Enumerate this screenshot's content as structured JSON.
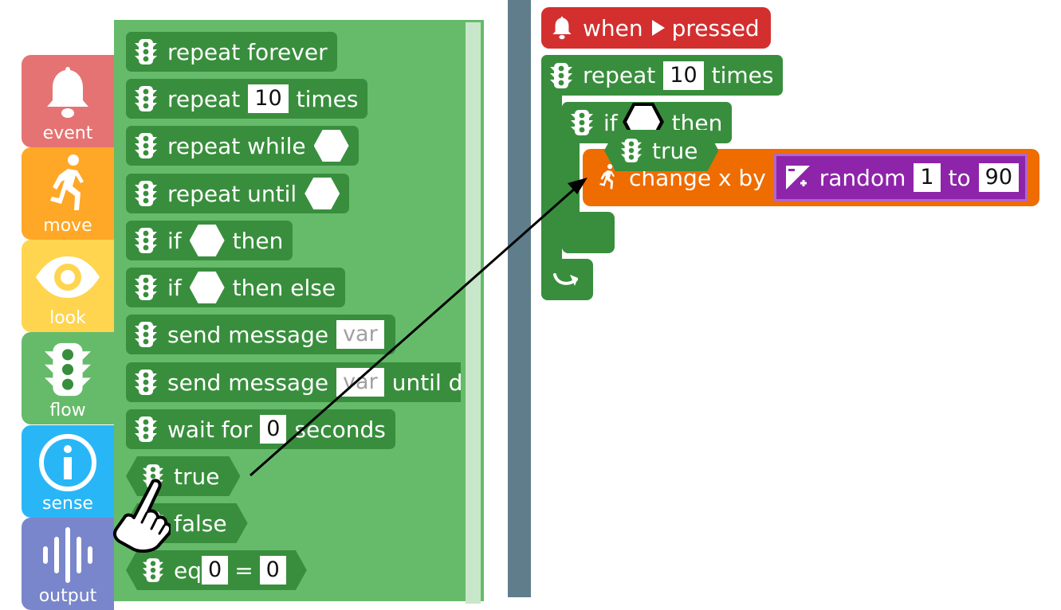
{
  "categories": [
    {
      "label": "event",
      "icon": "bell-icon",
      "color": "#e57373"
    },
    {
      "label": "move",
      "icon": "runner-icon",
      "color": "#ffa726"
    },
    {
      "label": "look",
      "icon": "eye-icon",
      "color": "#ffd54f"
    },
    {
      "label": "flow",
      "icon": "traffic-light-icon",
      "color": "#66bb6a"
    },
    {
      "label": "sense",
      "icon": "info-icon",
      "color": "#29b6f6"
    },
    {
      "label": "output",
      "icon": "sound-wave-icon",
      "color": "#7986cb"
    }
  ],
  "palette": {
    "repeat_forever": "repeat forever",
    "repeat_times": {
      "word1": "repeat",
      "value": "10",
      "word2": "times"
    },
    "repeat_while": "repeat while",
    "repeat_until": "repeat until",
    "if_then": {
      "word1": "if",
      "word2": "then"
    },
    "if_then_else": {
      "word1": "if",
      "word2": "then else"
    },
    "send_message": {
      "word1": "send message",
      "placeholder": "var"
    },
    "send_message_until": {
      "word1": "send message",
      "placeholder": "var",
      "word2": "until d"
    },
    "wait_for": {
      "word1": "wait for",
      "value": "0",
      "word2": "seconds"
    },
    "true": "true",
    "false": "false",
    "eq": {
      "word1": "eq",
      "left": "0",
      "op": "=",
      "right": "0"
    }
  },
  "script": {
    "when_pressed": {
      "word1": "when",
      "word2": "pressed"
    },
    "repeat": {
      "word1": "repeat",
      "value": "10",
      "word2": "times"
    },
    "if_then": {
      "word1": "if",
      "word2": "then"
    },
    "dragged_true": "true",
    "change_x": {
      "label": "change x by"
    },
    "random": {
      "word1": "random",
      "from": "1",
      "word2": "to",
      "to": "90"
    }
  },
  "colors": {
    "flow": "#388e3c",
    "palette_bg": "#66bb6a",
    "event_block": "#d32f2f",
    "move_block": "#ef6c00",
    "operator_block": "#8e24aa",
    "divider": "#607d8b"
  }
}
